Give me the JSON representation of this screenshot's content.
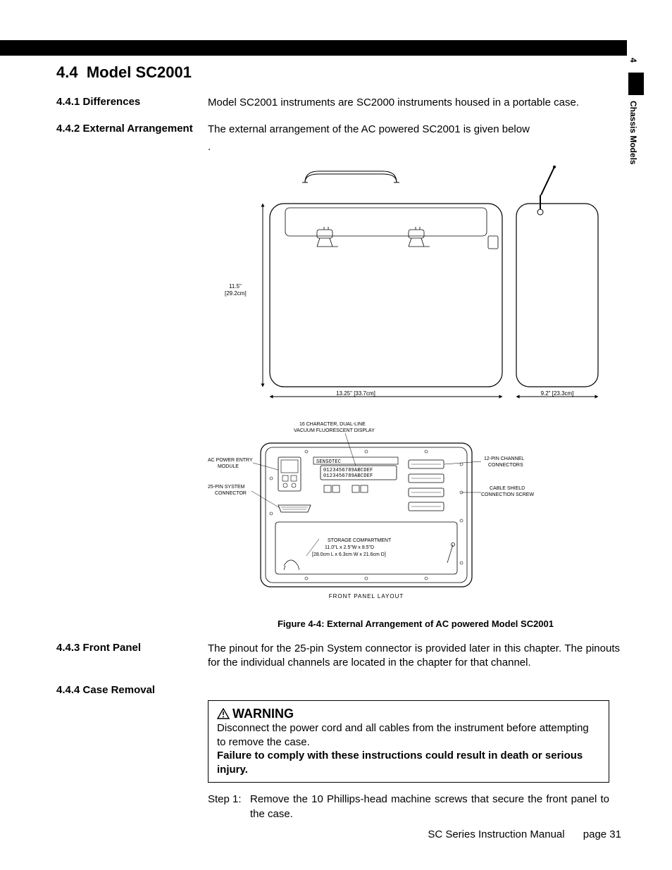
{
  "side_tab": {
    "chapter_number": "4",
    "chapter_title": "Chassis Models"
  },
  "section": {
    "number": "4.4",
    "title": "Model SC2001"
  },
  "subsections": {
    "differences": {
      "number": "4.4.1",
      "title": "Differences",
      "body": "Model SC2001 instruments are SC2000 instruments housed in a portable case."
    },
    "ext_arrangement": {
      "number": "4.4.2",
      "title": "External Arrangement",
      "body": "The external arrangement of the AC powered SC2001 is given below"
    },
    "front_panel": {
      "number": "4.4.3",
      "title": "Front Panel",
      "body": "The pinout for the 25-pin System connector is provided later in this chapter.    The pinouts for the individual channels are located in the chapter for that channel."
    },
    "case_removal": {
      "number": "4.4.4",
      "title": "Case Removal"
    }
  },
  "figure": {
    "caption": "Figure 4-4: External Arrangement of AC powered Model SC2001",
    "top": {
      "height_dim": "11.5\"",
      "height_dim_metric": "[29.2cm]",
      "width_dim": "13.25\" [33.7cm]",
      "depth_dim": "9.2\" [23.3cm]"
    },
    "front": {
      "display_label_1": "16 CHARACTER, DUAL-LINE",
      "display_label_2": "VACUUM FLUORESCENT DISPLAY",
      "power_entry_1": "AC POWER ENTRY",
      "power_entry_2": "MODULE",
      "system_conn_1": "25-PIN SYSTEM",
      "system_conn_2": "CONNECTOR",
      "channel_conn_1": "12-PIN CHANNEL",
      "channel_conn_2": "CONNECTORS",
      "shield_1": "CABLE SHIELD",
      "shield_2": "CONNECTION SCREW",
      "display_text": "0123456789ABCDEF",
      "brand": "SENSOTEC",
      "storage_1": "STORAGE COMPARTMENT",
      "storage_2": "11.0\"L x 2.5\"W x 8.5\"D",
      "storage_3": "[28.0cm L x 6.3cm W x 21.6cm D]",
      "layout_label": "FRONT PANEL LAYOUT"
    }
  },
  "warning": {
    "title": "WARNING",
    "line1": "Disconnect the power cord and all cables from the instrument before attempting to remove the case.",
    "line2": "Failure to comply with these instructions could result in death or serious injury."
  },
  "steps": {
    "s1_label": "Step 1:",
    "s1_text": "Remove the 10 Phillips-head machine screws that secure the front panel to the case."
  },
  "footer": {
    "manual": "SC Series Instruction Manual",
    "page": "page 31"
  }
}
